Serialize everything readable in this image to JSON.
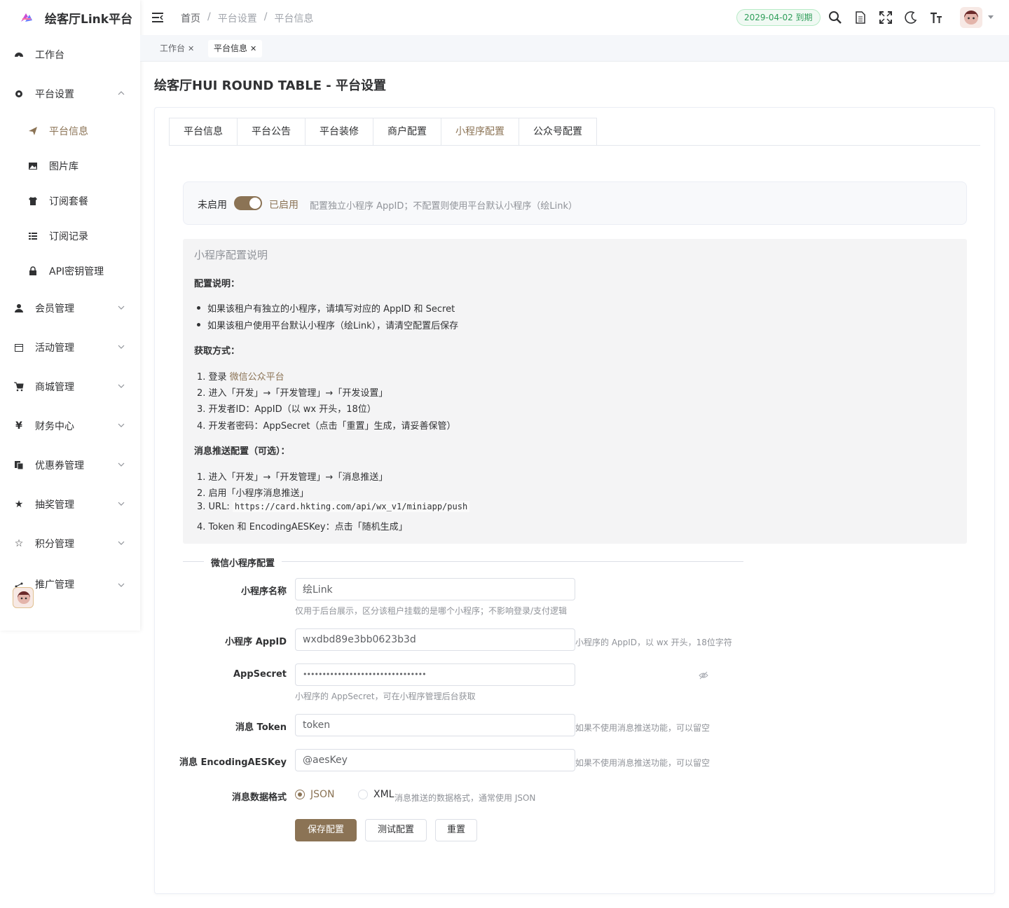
{
  "app": {
    "title": "绘客厅Link平台"
  },
  "sidebar": {
    "items": [
      {
        "label": "工作台"
      },
      {
        "label": "平台设置"
      },
      {
        "label": "会员管理"
      },
      {
        "label": "活动管理"
      },
      {
        "label": "商城管理"
      },
      {
        "label": "财务中心"
      },
      {
        "label": "优惠券管理"
      },
      {
        "label": "抽奖管理"
      },
      {
        "label": "积分管理"
      },
      {
        "label": "推广管理"
      }
    ],
    "sub_items": [
      {
        "label": "平台信息"
      },
      {
        "label": "图片库"
      },
      {
        "label": "订阅套餐"
      },
      {
        "label": "订阅记录"
      },
      {
        "label": "API密钥管理"
      }
    ]
  },
  "header": {
    "breadcrumb": [
      "首页",
      "平台设置",
      "平台信息"
    ],
    "expire": "2029-04-02 到期"
  },
  "tagsbar": {
    "tags": [
      "工作台",
      "平台信息"
    ]
  },
  "page": {
    "title": "绘客厅HUI ROUND TABLE - 平台设置"
  },
  "tabs": [
    "平台信息",
    "平台公告",
    "平台装修",
    "商户配置",
    "小程序配置",
    "公众号配置"
  ],
  "switch": {
    "off_label": "未启用",
    "on_label": "已启用",
    "enabled": true,
    "hint": "配置独立小程序 AppID；不配置则使用平台默认小程序（绘Link）"
  },
  "info": {
    "title": "小程序配置说明",
    "config_heading": "配置说明：",
    "config_items": [
      "如果该租户有独立的小程序，请填写对应的 AppID 和 Secret",
      "如果该租户使用平台默认小程序（绘Link），请清空配置后保存"
    ],
    "obtain_heading": "获取方式：",
    "obtain_step1_prefix": "1. 登录 ",
    "obtain_step1_link": "微信公众平台",
    "obtain_steps": [
      "2. 进入「开发」→「开发管理」→「开发设置」",
      "3. 开发者ID：AppID（以 wx 开头，18位）",
      "4. 开发者密码：AppSecret（点击「重置」生成，请妥善保管）"
    ],
    "push_heading": "消息推送配置（可选）：",
    "push_steps": [
      "1. 进入「开发」→「开发管理」→「消息推送」",
      "2. 启用「小程序消息推送」"
    ],
    "push_step3_prefix": "3. URL: ",
    "push_url": "https://card.hkting.com/api/wx_v1/miniapp/push",
    "push_step4": "4. Token 和 EncodingAESKey：点击「随机生成」"
  },
  "form": {
    "section_title": "微信小程序配置",
    "name": {
      "label": "小程序名称",
      "value": "绘Link",
      "help": "仅用于后台展示，区分该租户挂载的是哪个小程序；不影响登录/支付逻辑"
    },
    "appid": {
      "label": "小程序 AppID",
      "value": "wxdbd89e3bb0623b3d",
      "help": "小程序的 AppID，以 wx 开头，18位字符"
    },
    "secret": {
      "label": "AppSecret",
      "value": "••••••••••••••••••••••••••••••••",
      "help": "小程序的 AppSecret，可在小程序管理后台获取"
    },
    "token": {
      "label": "消息 Token",
      "value": "token",
      "help": "如果不使用消息推送功能，可以留空"
    },
    "aeskey": {
      "label": "消息 EncodingAESKey",
      "value": "@aesKey",
      "help": "如果不使用消息推送功能，可以留空"
    },
    "format": {
      "label": "消息数据格式",
      "options": [
        "JSON",
        "XML"
      ],
      "selected": "JSON",
      "help": "消息推送的数据格式，通常使用 JSON"
    },
    "buttons": {
      "save": "保存配置",
      "test": "测试配置",
      "reset": "重置"
    }
  },
  "colors": {
    "accent": "#8b7355",
    "badge_green": "#2f9e5a"
  }
}
